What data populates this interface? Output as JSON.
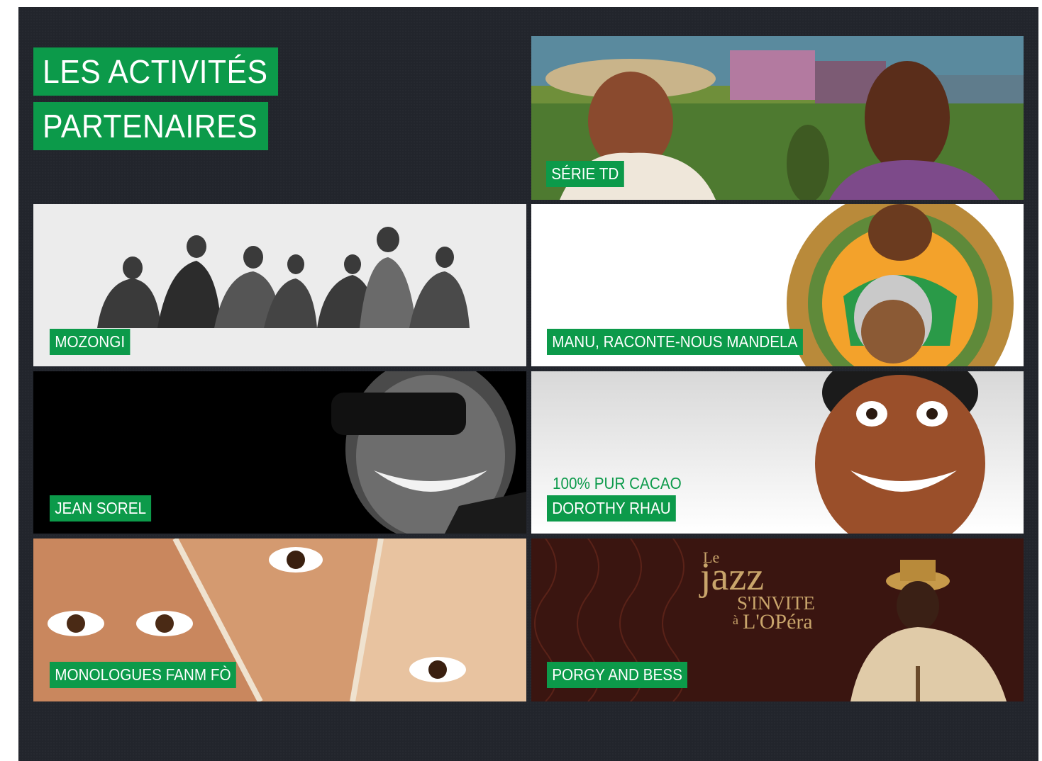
{
  "header": {
    "title_line1": "LES ACTIVITÉS",
    "title_line2": "PARTENAIRES"
  },
  "tiles": [
    {
      "label": "SÉRIE TD"
    },
    {
      "label": "MOZONGI"
    },
    {
      "label": "MANU, RACONTE-NOUS MANDELA"
    },
    {
      "label": "JEAN SOREL"
    },
    {
      "label": "DOROTHY RHAU",
      "subtitle": "100% PUR CACAO"
    },
    {
      "label": "MONOLOGUES FANM FÒ"
    },
    {
      "label": "PORGY AND BESS",
      "logo": {
        "le": "Le",
        "jazz": "jazz",
        "invite": "S'INVITE",
        "a": "à",
        "opera": "L'OPéra"
      }
    }
  ],
  "colors": {
    "accent_green": "#0c9a4a",
    "background": "#22252c"
  }
}
